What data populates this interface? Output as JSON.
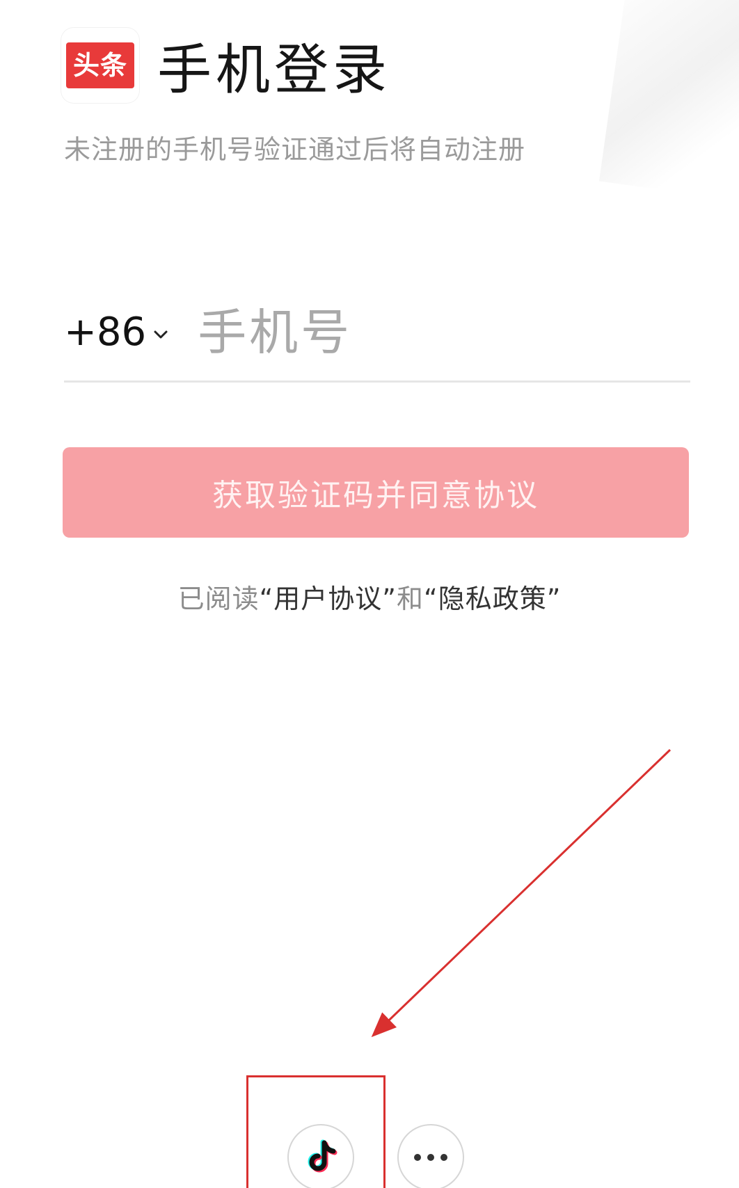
{
  "logo": {
    "text": "头条"
  },
  "header": {
    "title": "手机登录"
  },
  "subtitle": "未注册的手机号验证通过后将自动注册",
  "phone": {
    "country_code": "+86",
    "placeholder": "手机号"
  },
  "primary_button": {
    "label": "获取验证码并同意协议"
  },
  "agreement": {
    "prefix": "已阅读",
    "user_agreement": "“用户协议”",
    "conjunction": "和",
    "privacy_policy": "“隐私政策”"
  },
  "alt_logins": [
    {
      "icon": "douyin-icon"
    },
    {
      "icon": "more-dots-icon"
    }
  ],
  "colors": {
    "accent": "#e83a3a",
    "button_disabled": "#f7a1a5",
    "annotation": "#d9302f"
  }
}
